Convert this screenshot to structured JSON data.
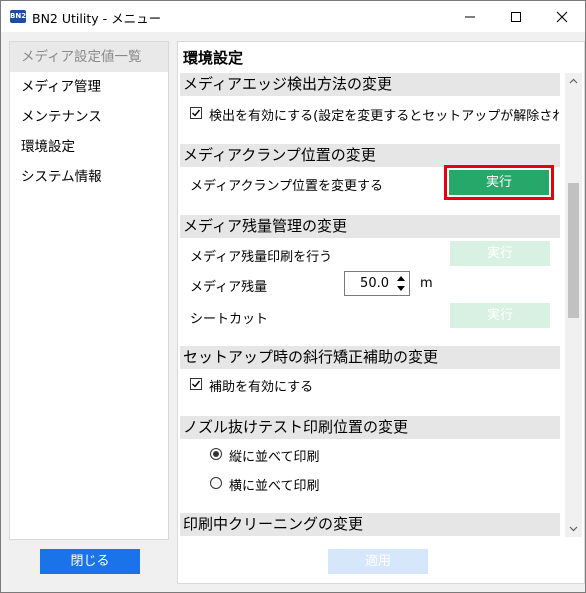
{
  "window": {
    "app_icon_text": "BN2",
    "title": "BN2 Utility - メニュー",
    "controls": [
      "minimize",
      "maximize",
      "close"
    ]
  },
  "sidebar": {
    "items": [
      {
        "label": "メディア設定値一覧",
        "active": true
      },
      {
        "label": "メディア管理",
        "active": false
      },
      {
        "label": "メンテナンス",
        "active": false
      },
      {
        "label": "環境設定",
        "active": false
      },
      {
        "label": "システム情報",
        "active": false
      }
    ]
  },
  "main": {
    "title": "環境設定",
    "sections": {
      "edge_detect": {
        "header": "メディアエッジ検出方法の変更",
        "checkbox_label": "検出を有効にする(設定を変更するとセットアップが解除され",
        "checked": true
      },
      "clamp": {
        "header": "メディアクランプ位置の変更",
        "row_label": "メディアクランプ位置を変更する",
        "button": "実行"
      },
      "remaining": {
        "header": "メディア残量管理の変更",
        "print_label": "メディア残量印刷を行う",
        "print_button": "実行",
        "amount_label": "メディア残量",
        "amount_value": "50.0",
        "amount_unit": "m",
        "sheet_cut_label": "シートカット",
        "sheet_cut_button": "実行"
      },
      "skew": {
        "header": "セットアップ時の斜行矯正補助の変更",
        "checkbox_label": "補助を有効にする",
        "checked": true
      },
      "nozzle": {
        "header": "ノズル抜けテスト印刷位置の変更",
        "options": [
          {
            "label": "縦に並べて印刷",
            "selected": true
          },
          {
            "label": "横に並べて印刷",
            "selected": false
          }
        ]
      },
      "cleaning": {
        "header": "印刷中クリーニングの変更"
      }
    },
    "apply_button": "適用"
  },
  "footer": {
    "close_button": "閉じる"
  },
  "colors": {
    "accent_green": "#26a86a",
    "disabled_green": "#d9f1e2",
    "primary_blue": "#1a73e8",
    "highlight_red": "#e60012"
  }
}
